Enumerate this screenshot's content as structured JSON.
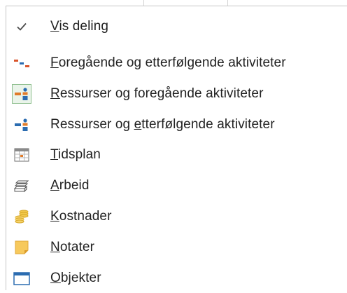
{
  "menu": {
    "items": [
      {
        "pre": "",
        "acc": "V",
        "post": "is deling",
        "icon": "checkmark-icon",
        "checked": true
      },
      {
        "pre": "",
        "acc": "F",
        "post": "oregående og etterfølgende aktiviteter",
        "icon": "predecessor-successor-icon"
      },
      {
        "pre": "",
        "acc": "R",
        "post": "essurser og foregående aktiviteter",
        "icon": "resources-predecessors-icon",
        "selected": true
      },
      {
        "pre": "Ressurser og ",
        "acc": "e",
        "post": "tterfølgende aktiviteter",
        "icon": "resources-successors-icon"
      },
      {
        "pre": "",
        "acc": "T",
        "post": "idsplan",
        "icon": "schedule-icon"
      },
      {
        "pre": "",
        "acc": "A",
        "post": "rbeid",
        "icon": "work-icon"
      },
      {
        "pre": "",
        "acc": "K",
        "post": "ostnader",
        "icon": "cost-icon"
      },
      {
        "pre": "",
        "acc": "N",
        "post": "otater",
        "icon": "notes-icon"
      },
      {
        "pre": "",
        "acc": "O",
        "post": "bjekter",
        "icon": "objects-icon"
      }
    ]
  }
}
